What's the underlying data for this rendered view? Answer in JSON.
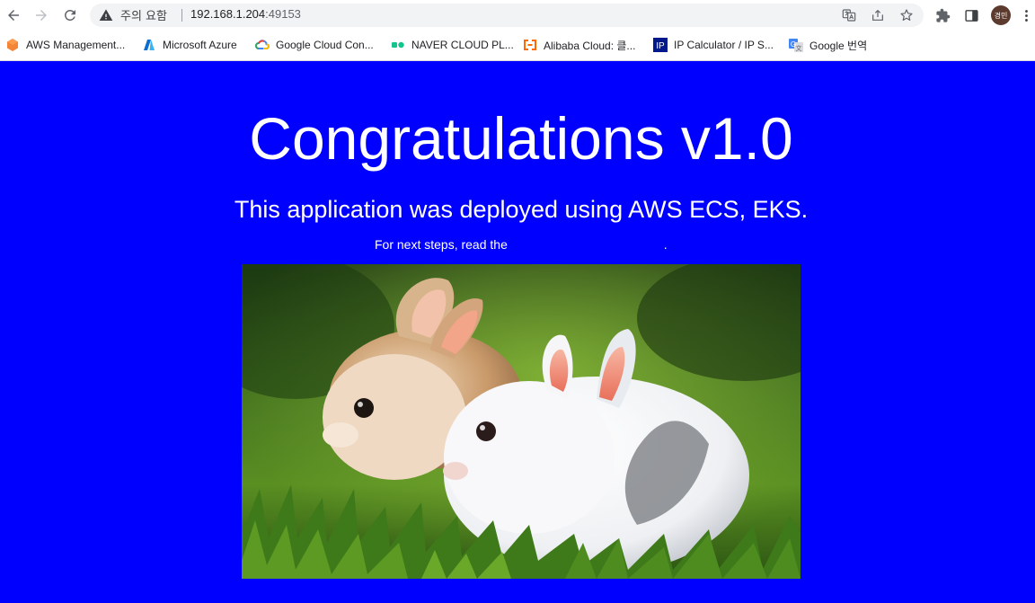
{
  "browser": {
    "security_label": "주의 요함",
    "url_host": "192.168.1.204",
    "url_port": ":49153",
    "profile_initials": "경민",
    "bookmarks": [
      {
        "label": "AWS Management...",
        "icon": "aws-icon"
      },
      {
        "label": "Microsoft Azure",
        "icon": "azure-icon"
      },
      {
        "label": "Google Cloud Con...",
        "icon": "google-cloud-icon"
      },
      {
        "label": "NAVER CLOUD PL...",
        "icon": "naver-cloud-icon"
      },
      {
        "label": "Alibaba Cloud: 클...",
        "icon": "alibaba-cloud-icon"
      },
      {
        "label": "IP Calculator / IP S...",
        "icon": "ip-calculator-icon"
      },
      {
        "label": "Google 번역",
        "icon": "google-translate-icon"
      }
    ]
  },
  "page": {
    "title": "Congratulations v1.0",
    "subtitle": "This application was deployed using AWS ECS, EKS.",
    "steps_prefix": "For next steps, read the ",
    "steps_link": "",
    "steps_suffix": ".",
    "image_subject": "two-rabbits-on-grass"
  },
  "colors": {
    "page_background": "#0000ff",
    "text": "#ffffff"
  }
}
